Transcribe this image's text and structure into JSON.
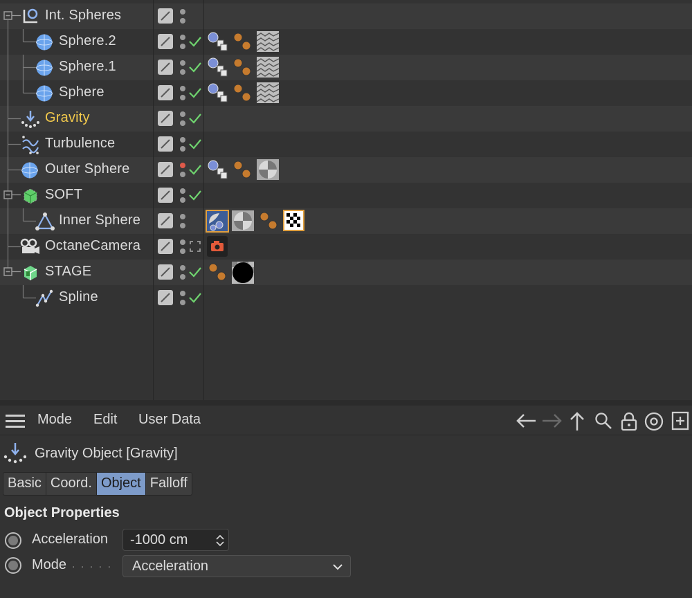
{
  "object_manager": {
    "rows": [
      {
        "name": "Int. Spheres",
        "icon": "null-object-icon",
        "highlight": false
      },
      {
        "name": "Sphere.2",
        "icon": "sphere-icon",
        "highlight": false
      },
      {
        "name": "Sphere.1",
        "icon": "sphere-icon",
        "highlight": false
      },
      {
        "name": "Sphere",
        "icon": "sphere-icon",
        "highlight": false
      },
      {
        "name": "Gravity",
        "icon": "gravity-icon",
        "highlight": true
      },
      {
        "name": "Turbulence",
        "icon": "turbulence-icon",
        "highlight": false
      },
      {
        "name": "Outer Sphere",
        "icon": "sphere-icon",
        "highlight": false
      },
      {
        "name": "SOFT",
        "icon": "soft-body-icon",
        "highlight": false
      },
      {
        "name": "Inner Sphere",
        "icon": "polygon-object-icon",
        "highlight": false
      },
      {
        "name": "OctaneCamera",
        "icon": "camera-icon",
        "highlight": false
      },
      {
        "name": "STAGE",
        "icon": "stage-icon",
        "highlight": false
      },
      {
        "name": "Spline",
        "icon": "spline-icon",
        "highlight": false
      }
    ],
    "colors": {
      "highlight": "#f2c94c",
      "check": "#6fd46f",
      "red_dot": "#e05a4a",
      "active_tab": "#7d9bc9"
    }
  },
  "attribute_manager": {
    "menu": {
      "mode": "Mode",
      "edit": "Edit",
      "user_data": "User Data"
    },
    "toolbar_icons": [
      "back-arrow-icon",
      "forward-arrow-icon",
      "up-arrow-icon",
      "search-icon",
      "lock-icon",
      "target-icon",
      "new-panel-icon"
    ],
    "object_title": "Gravity Object [Gravity]",
    "tabs": {
      "basic": "Basic",
      "coord": "Coord.",
      "object": "Object",
      "falloff": "Falloff"
    },
    "active_tab": "Object",
    "section_title": "Object Properties",
    "acceleration": {
      "label": "Acceleration",
      "value": "-1000 cm"
    },
    "mode": {
      "label": "Mode",
      "leader": ". . . . .",
      "value": "Acceleration"
    }
  }
}
